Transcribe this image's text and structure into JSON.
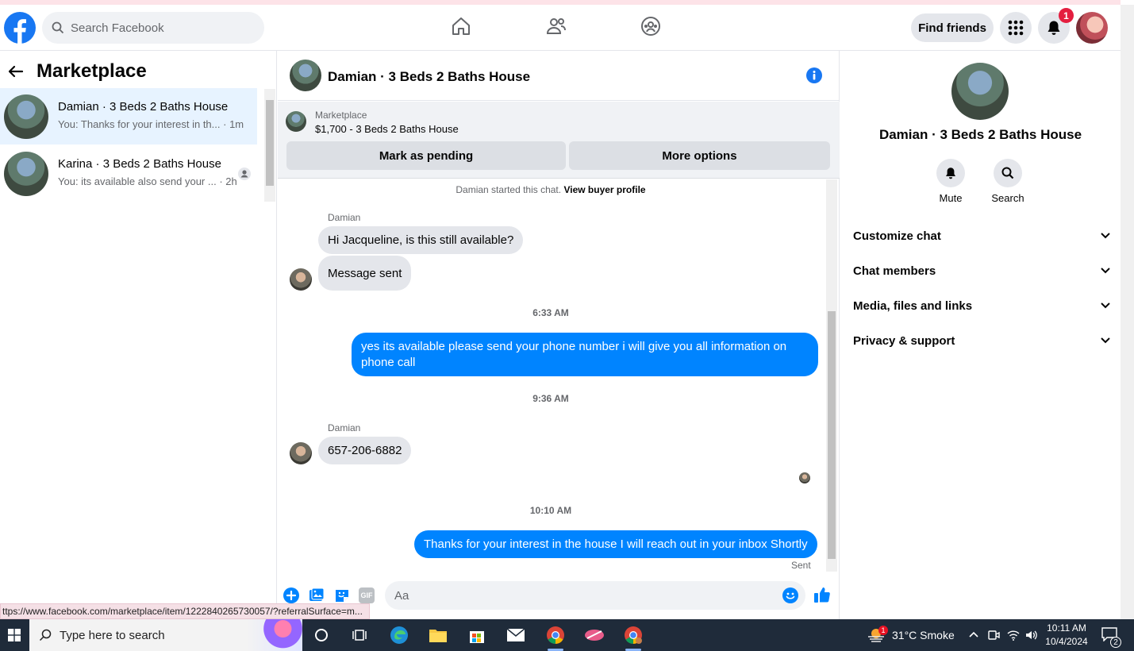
{
  "topbar": {
    "search_placeholder": "Search Facebook",
    "find_friends": "Find friends",
    "notification_count": "1",
    "brand_color": "#1877f2"
  },
  "left": {
    "title": "Marketplace",
    "conversations": [
      {
        "name": "Damian · 3 Beds 2 Baths House",
        "preview": "You: Thanks for your interest in th...",
        "time": "· 1m",
        "active": true
      },
      {
        "name": "Karina · 3 Beds 2 Baths House",
        "preview": "You: its available also send your ...",
        "time": "· 2h",
        "active": false
      }
    ]
  },
  "chat": {
    "title": "Damian · 3 Beds 2 Baths House",
    "listing_label": "Marketplace",
    "listing_price": "$1,700 - 3 Beds 2 Baths House",
    "mark_pending": "Mark as pending",
    "more_options": "More options",
    "started_text": "Damian started this chat.",
    "buyer_profile_link": "View buyer profile",
    "sender_name": "Damian",
    "messages": {
      "in1": "Hi Jacqueline, is this still available?",
      "in2": "Message sent",
      "ts1": "6:33 AM",
      "out1": "yes its available please send your phone number i will give you all information on phone call",
      "ts2": "9:36 AM",
      "in3": "657-206-6882",
      "ts3": "10:10 AM",
      "out2": "Thanks for your interest in the house I will reach out in your inbox Shortly",
      "status": "Sent"
    },
    "input_placeholder": "Aa",
    "gif_label": "GIF",
    "outgoing_color": "#0084ff"
  },
  "right": {
    "name": "Damian · 3 Beds 2 Baths House",
    "mute": "Mute",
    "search": "Search",
    "sections": [
      "Customize chat",
      "Chat members",
      "Media, files and links",
      "Privacy & support"
    ]
  },
  "status_url": "ttps://www.facebook.com/marketplace/item/1222840265730057/?referralSurface=m...",
  "taskbar": {
    "search_placeholder": "Type here to search",
    "weather": "31°C  Smoke",
    "weather_badge": "1",
    "time": "10:11 AM",
    "date": "10/4/2024",
    "notif_count": "2"
  }
}
